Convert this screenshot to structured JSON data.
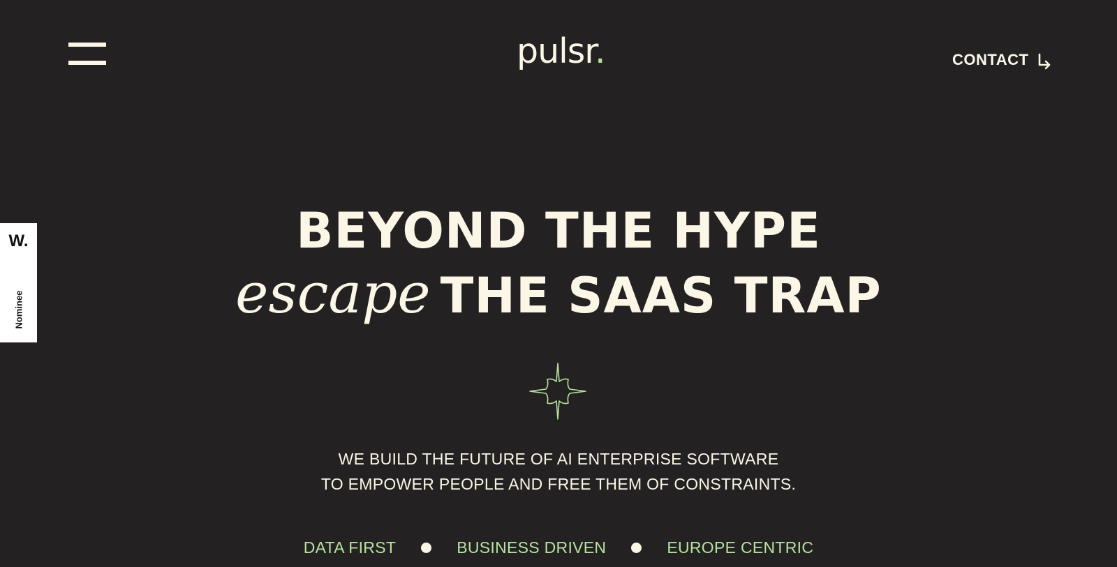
{
  "header": {
    "logo_text": "pulsr",
    "logo_dot": ".",
    "contact_label": "CONTACT",
    "contact_icon": "arrow-down-right-icon",
    "menu_icon": "hamburger-menu-icon"
  },
  "badge": {
    "mark": "W.",
    "label": "Nominee"
  },
  "hero": {
    "line1": "BEYOND THE HYPE",
    "line2_italic": "escape",
    "line2_rest": "THE SAAS TRAP",
    "star_icon": "sparkle-star-icon"
  },
  "tagline": {
    "line1": "WE BUILD THE FUTURE OF AI ENTERPRISE SOFTWARE",
    "line2": "TO EMPOWER PEOPLE AND FREE THEM OF CONSTRAINTS."
  },
  "values": [
    "DATA FIRST",
    "BUSINESS DRIVEN",
    "EUROPE CENTRIC"
  ],
  "colors": {
    "background": "#232122",
    "text": "#fbf6e6",
    "accent": "#b8e29f",
    "badge_bg": "#ffffff"
  }
}
